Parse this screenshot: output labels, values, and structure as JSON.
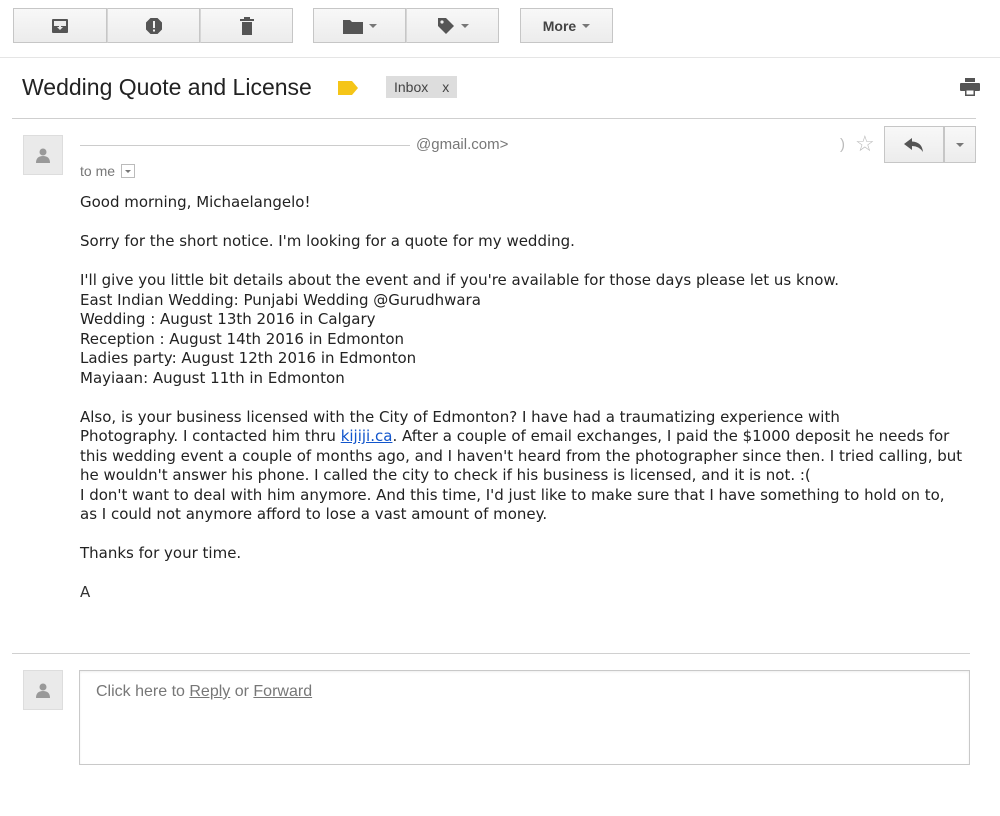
{
  "toolbar": {
    "more_label": "More"
  },
  "message": {
    "subject": "Wedding Quote and License",
    "label_chip": "Inbox",
    "label_chip_close": "x",
    "sender_partial": "@gmail.com>",
    "date_partial": ")",
    "to_me": "to me",
    "greeting": "Good morning, Michaelangelo!",
    "line1": "Sorry for the short notice. I'm looking for a quote for my wedding.",
    "line2": "I'll give you little bit details about the event and if you're available for those days please let us know.",
    "line3": "East Indian Wedding: Punjabi Wedding @Gurudhwara",
    "line4": "Wedding : August 13th 2016 in Calgary",
    "line5": "Reception : August 14th 2016 in Edmonton",
    "line6": "Ladies party: August 12th 2016 in Edmonton",
    "line7": "Mayiaan: August 11th in Edmonton",
    "para_a1": "Also, is your business licensed with the City of Edmonton? I have had a traumatizing experience with",
    "para_a2_pre": "Photography. I contacted him thru ",
    "para_a2_link": "kijiji.ca",
    "para_a2_post": ". After a couple of email exchanges, I paid the $1000 deposit he needs for",
    "para_a3": "this wedding event a couple of months ago, and I haven't heard from the photographer since then. I tried calling, but",
    "para_a4": "he wouldn't answer his phone. I called the city to check if his business is licensed, and it is not. :(",
    "para_a5": "I don't want to deal with him anymore. And this time, I'd just like to make sure that I have something to hold on to,",
    "para_a6": "as I could not anymore afford to lose a vast amount of money.",
    "thanks": "Thanks for your time.",
    "signature": "A"
  },
  "reply": {
    "prefix": "Click here to ",
    "reply_link": "Reply",
    "middle": " or ",
    "forward_link": "Forward"
  },
  "colors": {
    "label_tag": "#f5c518",
    "link": "#1155cc"
  }
}
